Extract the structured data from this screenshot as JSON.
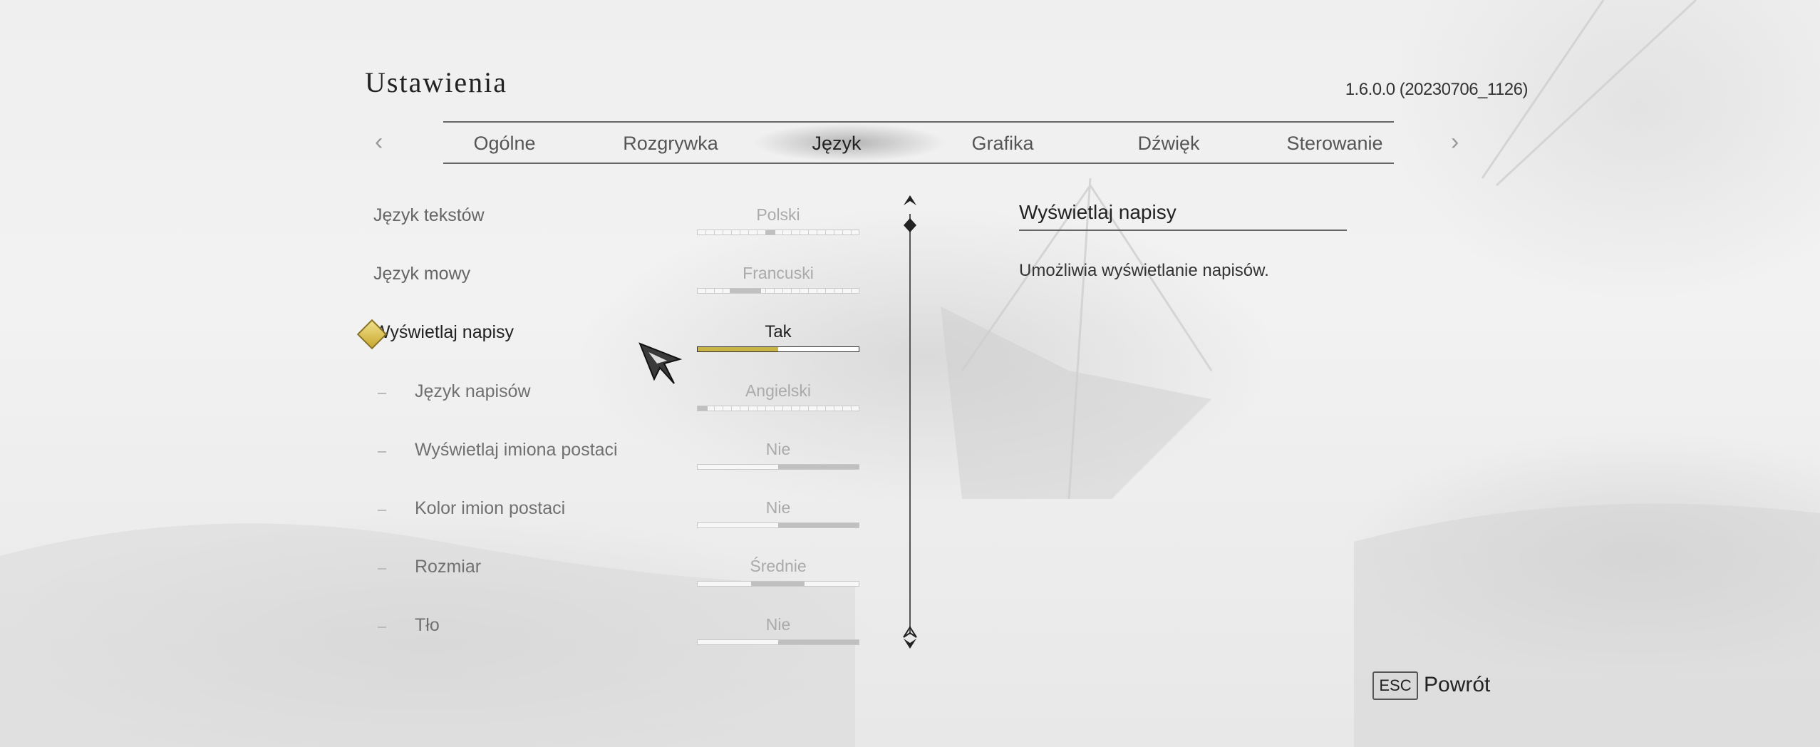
{
  "header": {
    "title": "Ustawienia",
    "version": "1.6.0.0 (20230706_1126)"
  },
  "tabs": [
    {
      "label": "Ogólne",
      "active": false
    },
    {
      "label": "Rozgrywka",
      "active": false
    },
    {
      "label": "Język",
      "active": true
    },
    {
      "label": "Grafika",
      "active": false
    },
    {
      "label": "Dźwięk",
      "active": false
    },
    {
      "label": "Sterowanie",
      "active": false
    }
  ],
  "settings": [
    {
      "label": "Język tekstów",
      "value": "Polski",
      "selected": false,
      "sub": false,
      "level": 0.42,
      "type": "list"
    },
    {
      "label": "Język mowy",
      "value": "Francuski",
      "selected": false,
      "sub": false,
      "level": 0.2,
      "type": "list"
    },
    {
      "label": "Wyświetlaj napisy",
      "value": "Tak",
      "selected": true,
      "sub": false,
      "level": 0.5,
      "type": "toggle"
    },
    {
      "label": "Język napisów",
      "value": "Angielski",
      "selected": false,
      "sub": true,
      "level": 0.0,
      "type": "list"
    },
    {
      "label": "Wyświetlaj imiona postaci",
      "value": "Nie",
      "selected": false,
      "sub": true,
      "level": 0.5,
      "type": "toggle"
    },
    {
      "label": "Kolor imion postaci",
      "value": "Nie",
      "selected": false,
      "sub": true,
      "level": 0.5,
      "type": "toggle"
    },
    {
      "label": "Rozmiar",
      "value": "Średnie",
      "selected": false,
      "sub": true,
      "level": 0.33,
      "type": "range"
    },
    {
      "label": "Tło",
      "value": "Nie",
      "selected": false,
      "sub": true,
      "level": 0.5,
      "type": "toggle"
    }
  ],
  "description": {
    "title": "Wyświetlaj napisy",
    "text": "Umożliwia wyświetlanie napisów."
  },
  "footer": {
    "key": "ESC",
    "label": "Powrót"
  },
  "colors": {
    "accent": "#c9b445",
    "text": "#222222",
    "muted": "#aaaaaa"
  },
  "icons": {
    "prev": "chevron-left-icon",
    "next": "chevron-right-icon",
    "cursor": "arrow-cursor-icon",
    "selection": "diamond-marker-icon"
  }
}
